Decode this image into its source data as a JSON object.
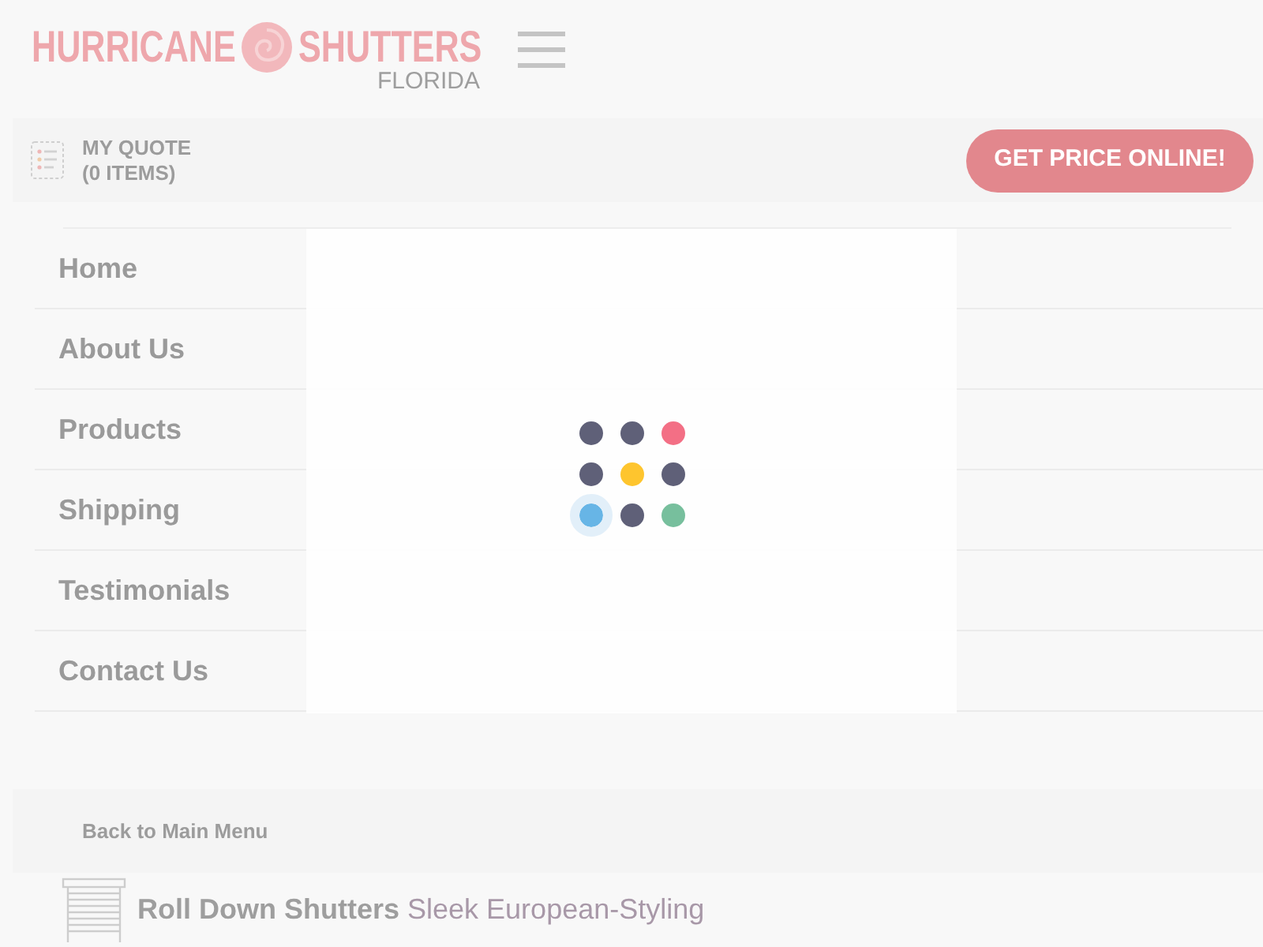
{
  "header": {
    "logo": {
      "word_1": "HURRICANE",
      "word_2": "SHUTTERS",
      "subtitle": "FLORIDA"
    }
  },
  "quote_bar": {
    "quote_link": [
      "MY QUOTE",
      "(0 ITEMS)"
    ],
    "button": "GET PRICE ONLINE!"
  },
  "menu": {
    "items": [
      {
        "label": "Home"
      },
      {
        "label": "About Us"
      },
      {
        "label": "Products"
      },
      {
        "label": "Shipping"
      },
      {
        "label": "Testimonials"
      },
      {
        "label": "Contact Us"
      }
    ]
  },
  "back_link": "Back to Main Menu",
  "product": {
    "name": "Roll Down Shutters",
    "tagline": "Sleek European-Styling"
  },
  "loader": {
    "dots": [
      {
        "color": "#5f6078",
        "active": false
      },
      {
        "color": "#5f6078",
        "active": false
      },
      {
        "color": "#f36f85",
        "active": false
      },
      {
        "color": "#5f6078",
        "active": false
      },
      {
        "color": "#fec52e",
        "active": false
      },
      {
        "color": "#5f6078",
        "active": false
      },
      {
        "color": "#67b5e6",
        "active": true
      },
      {
        "color": "#5f6078",
        "active": false
      },
      {
        "color": "#77bf9d",
        "active": false
      }
    ]
  }
}
